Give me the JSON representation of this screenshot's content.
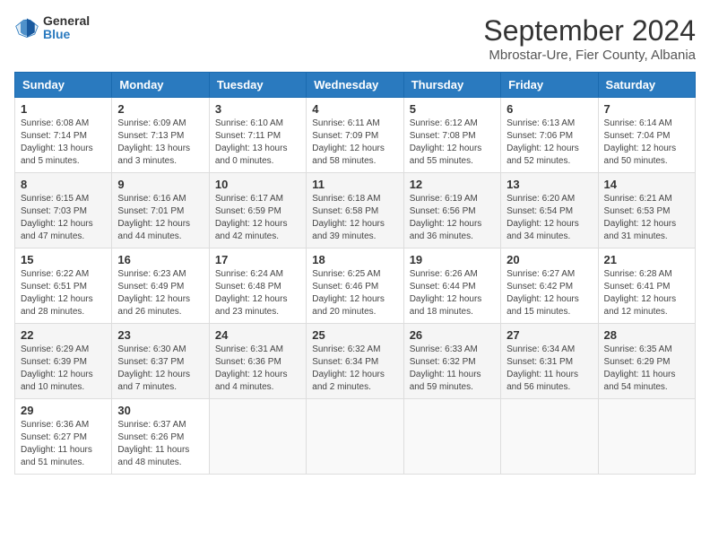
{
  "logo": {
    "general": "General",
    "blue": "Blue"
  },
  "title": "September 2024",
  "location": "Mbrostar-Ure, Fier County, Albania",
  "headers": [
    "Sunday",
    "Monday",
    "Tuesday",
    "Wednesday",
    "Thursday",
    "Friday",
    "Saturday"
  ],
  "weeks": [
    [
      {
        "day": "1",
        "sunrise": "6:08 AM",
        "sunset": "7:14 PM",
        "daylight": "13 hours and 5 minutes."
      },
      {
        "day": "2",
        "sunrise": "6:09 AM",
        "sunset": "7:13 PM",
        "daylight": "13 hours and 3 minutes."
      },
      {
        "day": "3",
        "sunrise": "6:10 AM",
        "sunset": "7:11 PM",
        "daylight": "13 hours and 0 minutes."
      },
      {
        "day": "4",
        "sunrise": "6:11 AM",
        "sunset": "7:09 PM",
        "daylight": "12 hours and 58 minutes."
      },
      {
        "day": "5",
        "sunrise": "6:12 AM",
        "sunset": "7:08 PM",
        "daylight": "12 hours and 55 minutes."
      },
      {
        "day": "6",
        "sunrise": "6:13 AM",
        "sunset": "7:06 PM",
        "daylight": "12 hours and 52 minutes."
      },
      {
        "day": "7",
        "sunrise": "6:14 AM",
        "sunset": "7:04 PM",
        "daylight": "12 hours and 50 minutes."
      }
    ],
    [
      {
        "day": "8",
        "sunrise": "6:15 AM",
        "sunset": "7:03 PM",
        "daylight": "12 hours and 47 minutes."
      },
      {
        "day": "9",
        "sunrise": "6:16 AM",
        "sunset": "7:01 PM",
        "daylight": "12 hours and 44 minutes."
      },
      {
        "day": "10",
        "sunrise": "6:17 AM",
        "sunset": "6:59 PM",
        "daylight": "12 hours and 42 minutes."
      },
      {
        "day": "11",
        "sunrise": "6:18 AM",
        "sunset": "6:58 PM",
        "daylight": "12 hours and 39 minutes."
      },
      {
        "day": "12",
        "sunrise": "6:19 AM",
        "sunset": "6:56 PM",
        "daylight": "12 hours and 36 minutes."
      },
      {
        "day": "13",
        "sunrise": "6:20 AM",
        "sunset": "6:54 PM",
        "daylight": "12 hours and 34 minutes."
      },
      {
        "day": "14",
        "sunrise": "6:21 AM",
        "sunset": "6:53 PM",
        "daylight": "12 hours and 31 minutes."
      }
    ],
    [
      {
        "day": "15",
        "sunrise": "6:22 AM",
        "sunset": "6:51 PM",
        "daylight": "12 hours and 28 minutes."
      },
      {
        "day": "16",
        "sunrise": "6:23 AM",
        "sunset": "6:49 PM",
        "daylight": "12 hours and 26 minutes."
      },
      {
        "day": "17",
        "sunrise": "6:24 AM",
        "sunset": "6:48 PM",
        "daylight": "12 hours and 23 minutes."
      },
      {
        "day": "18",
        "sunrise": "6:25 AM",
        "sunset": "6:46 PM",
        "daylight": "12 hours and 20 minutes."
      },
      {
        "day": "19",
        "sunrise": "6:26 AM",
        "sunset": "6:44 PM",
        "daylight": "12 hours and 18 minutes."
      },
      {
        "day": "20",
        "sunrise": "6:27 AM",
        "sunset": "6:42 PM",
        "daylight": "12 hours and 15 minutes."
      },
      {
        "day": "21",
        "sunrise": "6:28 AM",
        "sunset": "6:41 PM",
        "daylight": "12 hours and 12 minutes."
      }
    ],
    [
      {
        "day": "22",
        "sunrise": "6:29 AM",
        "sunset": "6:39 PM",
        "daylight": "12 hours and 10 minutes."
      },
      {
        "day": "23",
        "sunrise": "6:30 AM",
        "sunset": "6:37 PM",
        "daylight": "12 hours and 7 minutes."
      },
      {
        "day": "24",
        "sunrise": "6:31 AM",
        "sunset": "6:36 PM",
        "daylight": "12 hours and 4 minutes."
      },
      {
        "day": "25",
        "sunrise": "6:32 AM",
        "sunset": "6:34 PM",
        "daylight": "12 hours and 2 minutes."
      },
      {
        "day": "26",
        "sunrise": "6:33 AM",
        "sunset": "6:32 PM",
        "daylight": "11 hours and 59 minutes."
      },
      {
        "day": "27",
        "sunrise": "6:34 AM",
        "sunset": "6:31 PM",
        "daylight": "11 hours and 56 minutes."
      },
      {
        "day": "28",
        "sunrise": "6:35 AM",
        "sunset": "6:29 PM",
        "daylight": "11 hours and 54 minutes."
      }
    ],
    [
      {
        "day": "29",
        "sunrise": "6:36 AM",
        "sunset": "6:27 PM",
        "daylight": "11 hours and 51 minutes."
      },
      {
        "day": "30",
        "sunrise": "6:37 AM",
        "sunset": "6:26 PM",
        "daylight": "11 hours and 48 minutes."
      },
      null,
      null,
      null,
      null,
      null
    ]
  ]
}
